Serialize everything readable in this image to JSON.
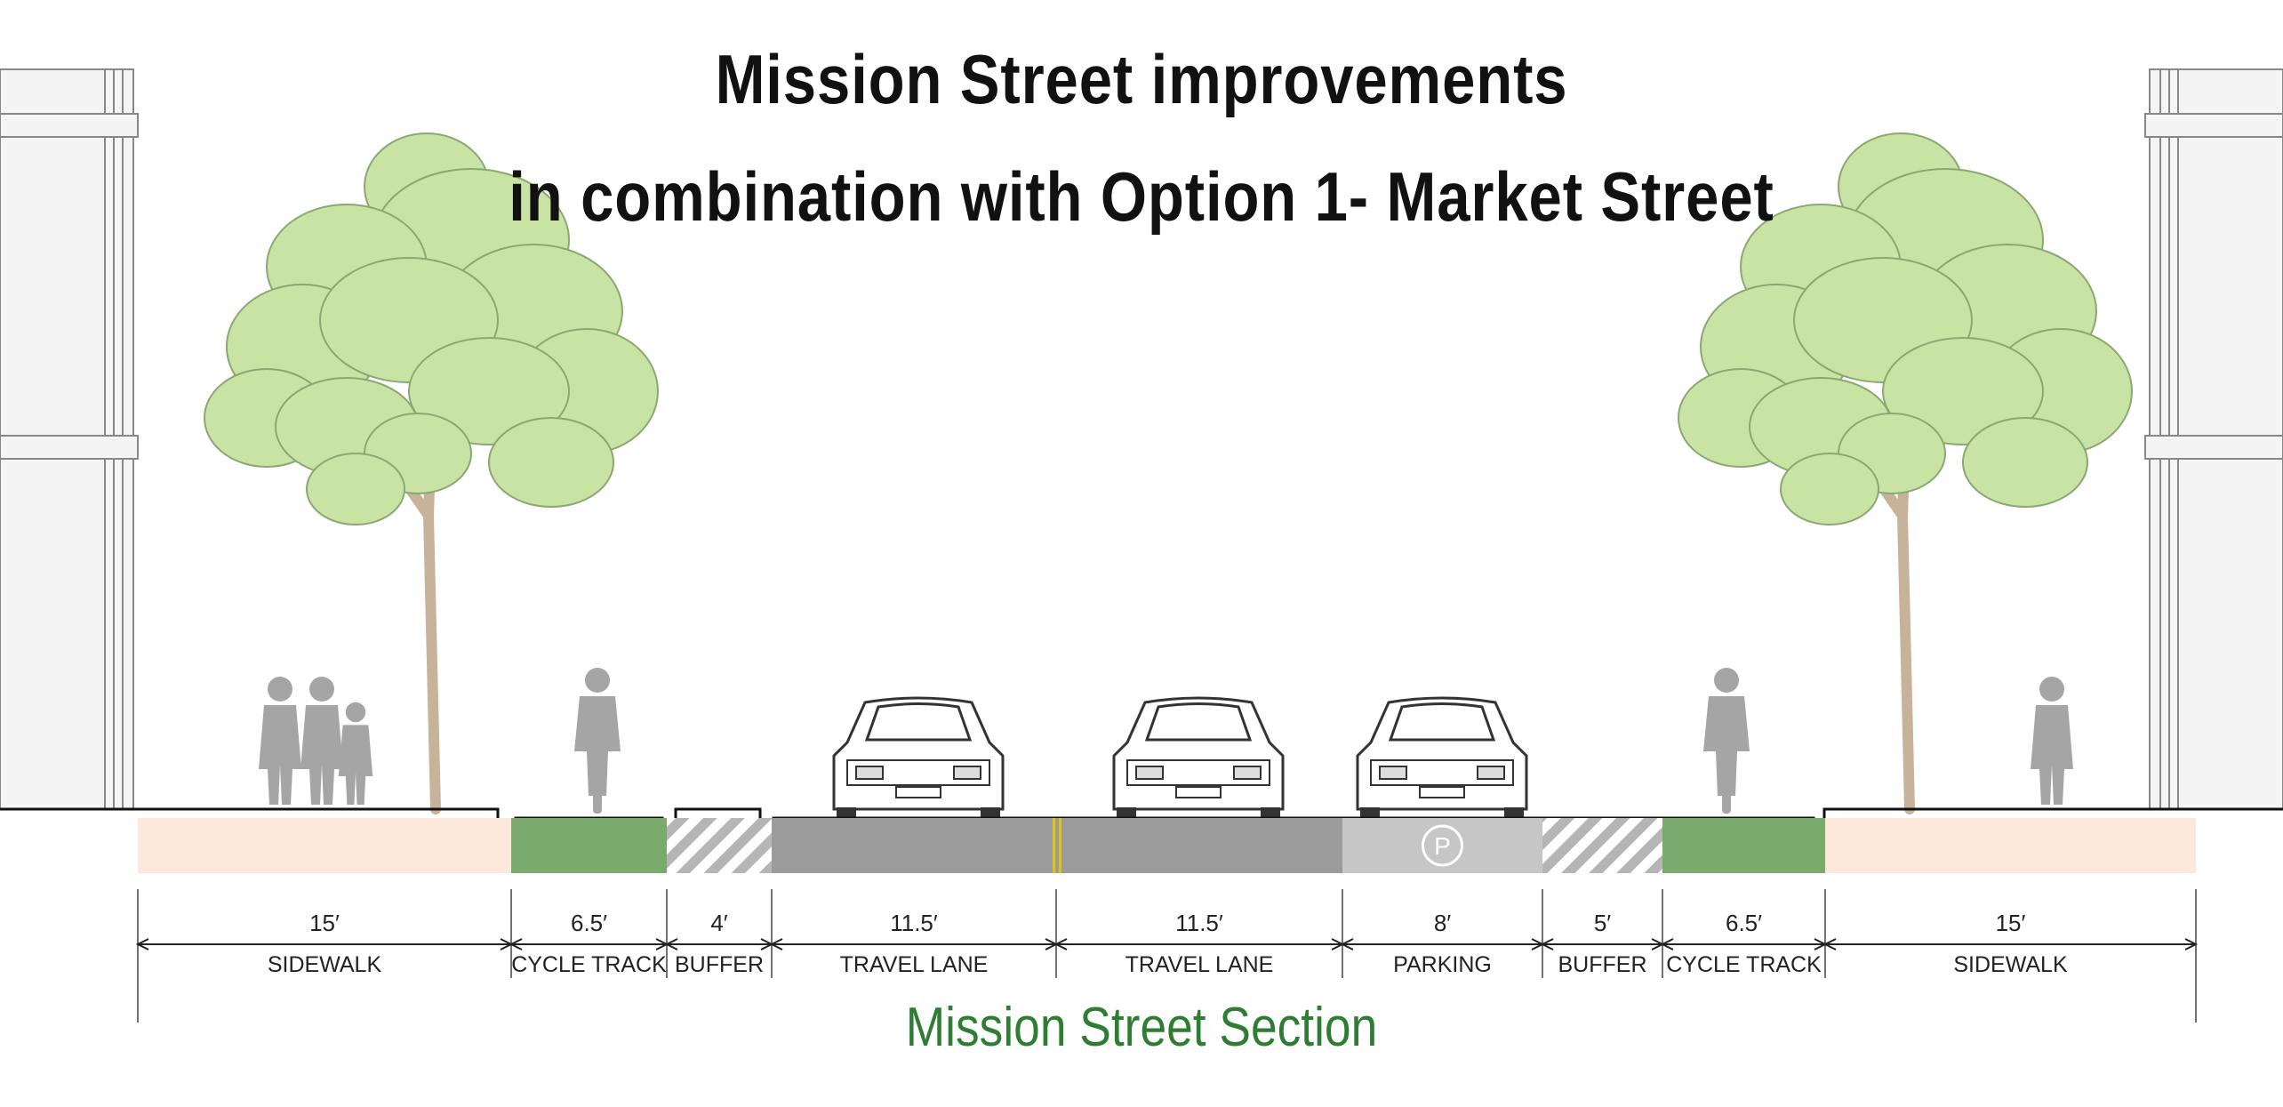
{
  "title": {
    "line1": "Mission Street improvements",
    "line2": "in combination with Option 1- Market Street"
  },
  "caption": "Mission Street Section",
  "colors": {
    "sidewalk": "#fde9dc",
    "cycle_track": "#7aab6d",
    "buffer_hatch": "#b5b5b5",
    "travel_lane": "#9b9b9b",
    "parking": "#c6c6c6",
    "centerline": "#e0c414",
    "tree_foliage": "#c9e3a4",
    "silhouette": "#a5a5a5",
    "caption": "#2e7d32"
  },
  "segments": [
    {
      "width": "15′",
      "label": "SIDEWALK",
      "type": "sidewalk"
    },
    {
      "width": "6.5′",
      "label": "CYCLE TRACK",
      "type": "cycle_track"
    },
    {
      "width": "4′",
      "label": "BUFFER",
      "type": "buffer"
    },
    {
      "width": "11.5′",
      "label": "TRAVEL LANE",
      "type": "travel_lane"
    },
    {
      "width": "11.5′",
      "label": "TRAVEL LANE",
      "type": "travel_lane"
    },
    {
      "width": "8′",
      "label": "PARKING",
      "type": "parking"
    },
    {
      "width": "5′",
      "label": "BUFFER",
      "type": "buffer"
    },
    {
      "width": "6.5′",
      "label": "CYCLE TRACK",
      "type": "cycle_track"
    },
    {
      "width": "15′",
      "label": "SIDEWALK",
      "type": "sidewalk"
    }
  ],
  "parking_symbol": "P",
  "icons": [
    "building-facade-icon",
    "tree-icon",
    "pedestrian-icon",
    "cyclist-icon",
    "car-front-icon",
    "car-rear-icon",
    "parking-sign-icon"
  ]
}
